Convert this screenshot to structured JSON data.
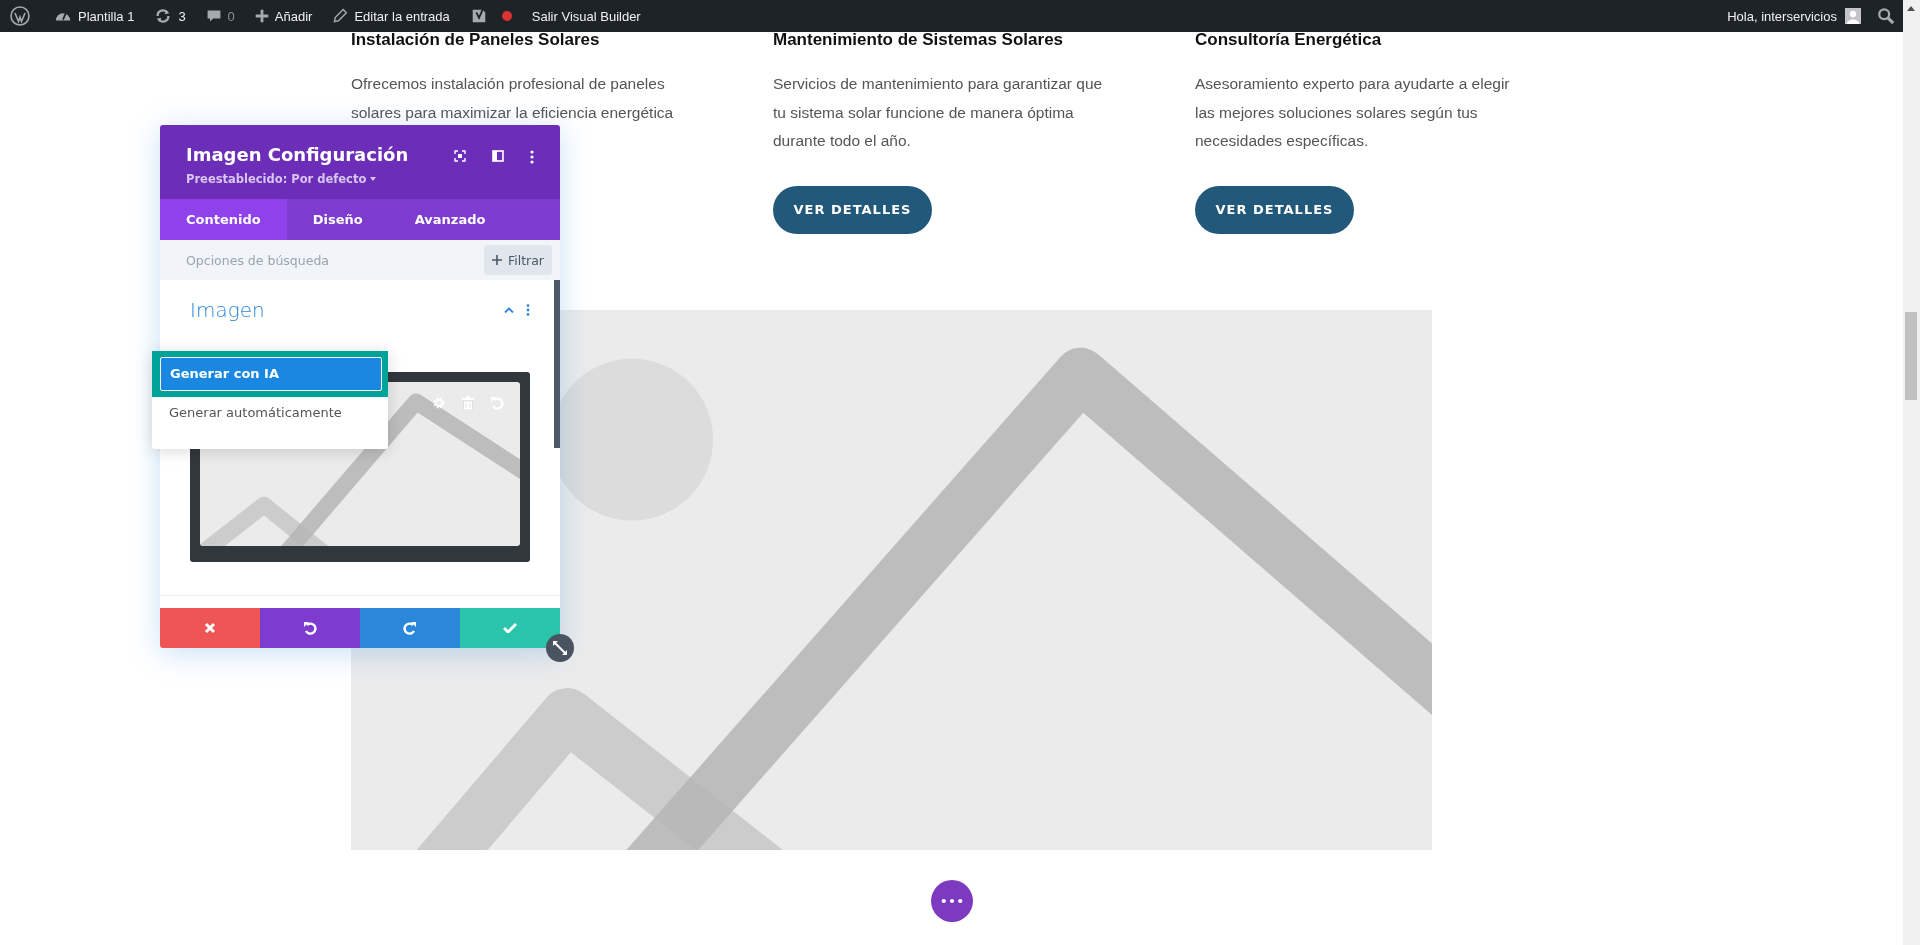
{
  "admin_bar": {
    "items": [
      {
        "kind": "logo"
      },
      {
        "kind": "site",
        "label": "Plantilla 1"
      },
      {
        "kind": "updates",
        "label": "3"
      },
      {
        "kind": "comments",
        "label": "0"
      },
      {
        "kind": "new",
        "label": "Añadir"
      },
      {
        "kind": "edit",
        "label": "Editar la entrada"
      },
      {
        "kind": "seo"
      },
      {
        "kind": "exit",
        "label": "Salir Visual Builder"
      }
    ],
    "greeting": "Hola, interservicios"
  },
  "services": [
    {
      "title": "Instalación de Paneles Solares",
      "description": "Ofrecemos instalación profesional de paneles solares para maximizar la eficiencia energética"
    },
    {
      "title": "Mantenimiento de Sistemas Solares",
      "description": "Servicios de mantenimiento para garantizar que tu sistema solar funcione de manera óptima durante todo el año.",
      "button": "VER DETALLES"
    },
    {
      "title": "Consultoría Energética",
      "description": "Asesoramiento experto para ayudarte a elegir las mejores soluciones solares según tus necesidades específicas.",
      "button": "VER DETALLES"
    }
  ],
  "settings_panel": {
    "title": "Imagen Configuración",
    "preset": "Preestablecido: Por defecto",
    "tabs": [
      {
        "label": "Contenido",
        "selected": true
      },
      {
        "label": "Diseño",
        "selected": false
      },
      {
        "label": "Avanzado",
        "selected": false
      }
    ],
    "search": {
      "placeholder": "Opciones de búsqueda"
    },
    "filter_button": "Filtrar",
    "section": {
      "title": "Imagen",
      "expanded": true
    },
    "menu": [
      {
        "label": "Generar con IA",
        "selected": true
      },
      {
        "label": "Generar automáticamente",
        "selected": false
      }
    ],
    "actions": [
      {
        "kind": "cancel"
      },
      {
        "kind": "undo"
      },
      {
        "kind": "redo"
      },
      {
        "kind": "save"
      }
    ]
  }
}
